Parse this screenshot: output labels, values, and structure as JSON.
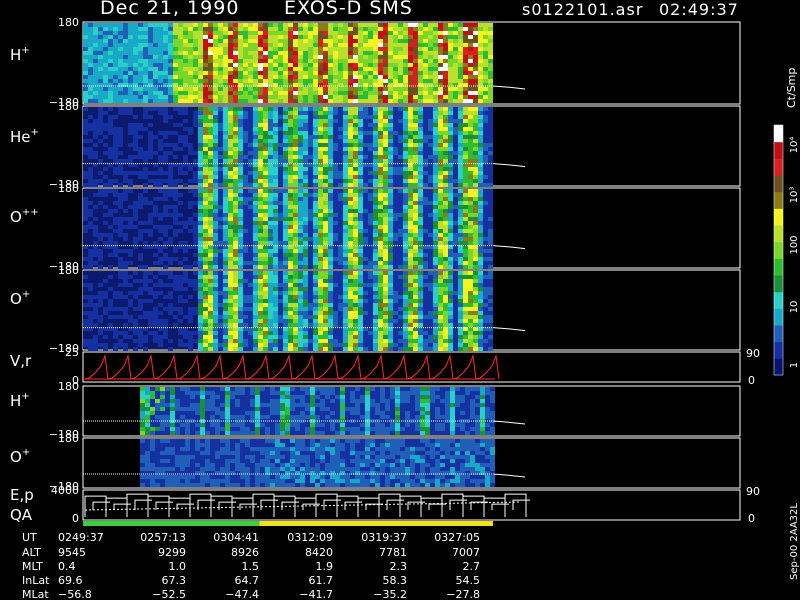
{
  "header": {
    "date": "Dec 21, 1990",
    "instrument": "EXOS-D SMS",
    "file": "s0122101.asr",
    "time": "02:49:37"
  },
  "chart_data": {
    "type": "heatmap",
    "panels": [
      {
        "label": "H",
        "superscript": "+",
        "ytop": "180",
        "ybot": "−180",
        "kind": "spec",
        "active_x": [
          83,
          493
        ],
        "baseline": 0.78
      },
      {
        "label": "He",
        "superscript": "+",
        "ytop": "180",
        "ybot": "−180",
        "kind": "spec",
        "active_x": [
          83,
          493
        ],
        "baseline": 0.72
      },
      {
        "label": "O",
        "superscript": "++",
        "ytop": "180",
        "ybot": "−180",
        "kind": "spec",
        "active_x": [
          83,
          493
        ],
        "baseline": 0.72
      },
      {
        "label": "O",
        "superscript": "+",
        "ytop": "180",
        "ybot": "−180",
        "kind": "spec",
        "active_x": [
          83,
          493
        ],
        "baseline": 0.72
      },
      {
        "label": "V,r",
        "superscript": "",
        "ytop": "25",
        "ybot": "0",
        "kind": "line",
        "right_top": "90",
        "right_bot": "0"
      },
      {
        "label": "H",
        "superscript": "+",
        "ytop": "180",
        "ybot": "−180",
        "kind": "spec2",
        "active_x": [
          140,
          493
        ],
        "baseline": 0.7
      },
      {
        "label": "O",
        "superscript": "+",
        "ytop": "180",
        "ybot": "−180",
        "kind": "spec2",
        "active_x": [
          140,
          493
        ],
        "baseline": 0.72
      },
      {
        "label": "E,p",
        "label2": "QA",
        "superscript": "",
        "ytop": "4000",
        "ybot": "0",
        "kind": "steps",
        "right_top": "90",
        "right_bot": "0"
      }
    ],
    "colorbar": {
      "title": "Ct/Smp",
      "labels": [
        "10⁴",
        "10³",
        "100",
        "10",
        "1"
      ]
    },
    "orbit_table": {
      "row_labels": [
        "UT",
        "ALT",
        "MLT",
        "InLat",
        "MLat"
      ],
      "columns": [
        [
          "0249:37",
          "9545",
          "0.4",
          "69.6",
          "−56.8"
        ],
        [
          "0257:13",
          "9299",
          "1.0",
          "67.3",
          "−52.5"
        ],
        [
          "0304:41",
          "8926",
          "1.5",
          "64.7",
          "−47.4"
        ],
        [
          "0312:09",
          "8420",
          "1.9",
          "61.7",
          "−41.7"
        ],
        [
          "0319:37",
          "7781",
          "2.3",
          "58.3",
          "−35.2"
        ],
        [
          "0327:05",
          "7007",
          "2.7",
          "54.5",
          "−27.8"
        ]
      ]
    },
    "side_label": "Sep-00  2AA32L",
    "qa_bar": [
      {
        "color": "#36d13c",
        "from": 0.0,
        "to": 0.43
      },
      {
        "color": "#f2e21b",
        "from": 0.43,
        "to": 1.0
      }
    ],
    "colors": {
      "background": "#000000",
      "field": "#0c1a6e",
      "scale": [
        "#0a1470",
        "#1530a0",
        "#1f5fb8",
        "#19a8c8",
        "#2ad0c8",
        "#1d8f3a",
        "#2dbd35",
        "#7ad62a",
        "#b8e02c",
        "#f3f320",
        "#8a7a18",
        "#6e5020",
        "#d82020",
        "#c01010",
        "#ffffff"
      ]
    }
  }
}
